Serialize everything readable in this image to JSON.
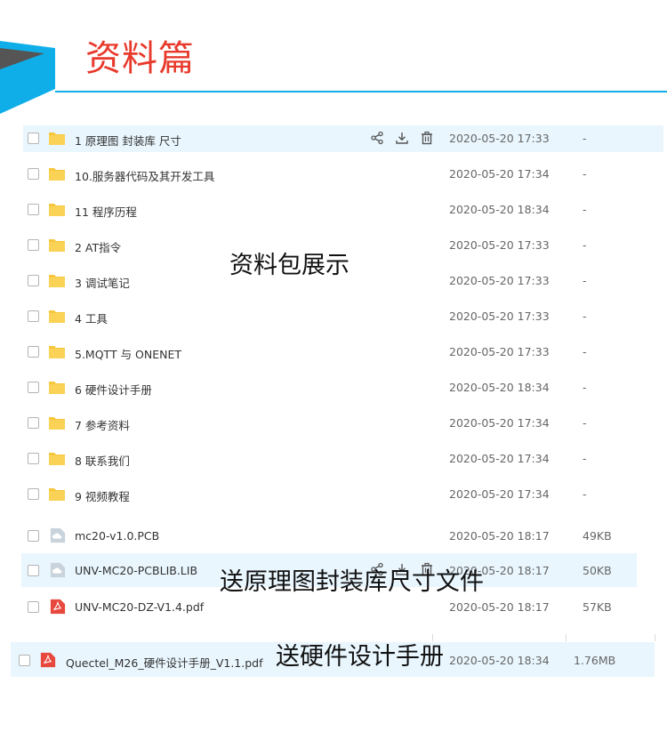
{
  "header": {
    "title": "资料篇"
  },
  "files": [
    {
      "name": "1 原理图 封装库 尺寸",
      "date": "2020-05-20 17:33",
      "size": "-",
      "type": "folder"
    },
    {
      "name": "10.服务器代码及其开发工具",
      "date": "2020-05-20 17:34",
      "size": "-",
      "type": "folder"
    },
    {
      "name": "11 程序历程",
      "date": "2020-05-20 18:34",
      "size": "-",
      "type": "folder"
    },
    {
      "name": "2 AT指令",
      "date": "2020-05-20 17:33",
      "size": "-",
      "type": "folder"
    },
    {
      "name": "3 调试笔记",
      "date": "2020-05-20 17:33",
      "size": "-",
      "type": "folder"
    },
    {
      "name": "4 工具",
      "date": "2020-05-20 17:33",
      "size": "-",
      "type": "folder"
    },
    {
      "name": "5.MQTT 与 ONENET",
      "date": "2020-05-20 17:33",
      "size": "-",
      "type": "folder"
    },
    {
      "name": "6 硬件设计手册",
      "date": "2020-05-20 18:34",
      "size": "-",
      "type": "folder"
    },
    {
      "name": "7 参考资料",
      "date": "2020-05-20 17:34",
      "size": "-",
      "type": "folder"
    },
    {
      "name": "8 联系我们",
      "date": "2020-05-20 17:34",
      "size": "-",
      "type": "folder"
    },
    {
      "name": "9 视频教程",
      "date": "2020-05-20 17:34",
      "size": "-",
      "type": "folder"
    },
    {
      "name": "mc20-v1.0.PCB",
      "date": "2020-05-20 18:17",
      "size": "49KB",
      "type": "cloud-file"
    },
    {
      "name": "UNV-MC20-PCBLIB.LIB",
      "date": "2020-05-20 18:17",
      "size": "50KB",
      "type": "cloud-file"
    },
    {
      "name": "UNV-MC20-DZ-V1.4.pdf",
      "date": "2020-05-20 18:17",
      "size": "57KB",
      "type": "pdf"
    },
    {
      "name": "Quectel_M26_硬件设计手册_V1.1.pdf",
      "date": "2020-05-20 18:34",
      "size": "1.76MB",
      "type": "pdf"
    }
  ],
  "captions": {
    "bundle": "资料包展示",
    "schematic": "送原理图封装库尺寸文件",
    "manual": "送硬件设计手册"
  },
  "colors": {
    "title_red": "#e83a2c",
    "accent_blue": "#10aee8",
    "folder_yellow": "#f6c73c",
    "pdf_red": "#e8493f",
    "row_highlight": "#e9f6fe"
  },
  "icons": {
    "row_actions": [
      "share-icon",
      "download-icon",
      "delete-icon"
    ]
  }
}
